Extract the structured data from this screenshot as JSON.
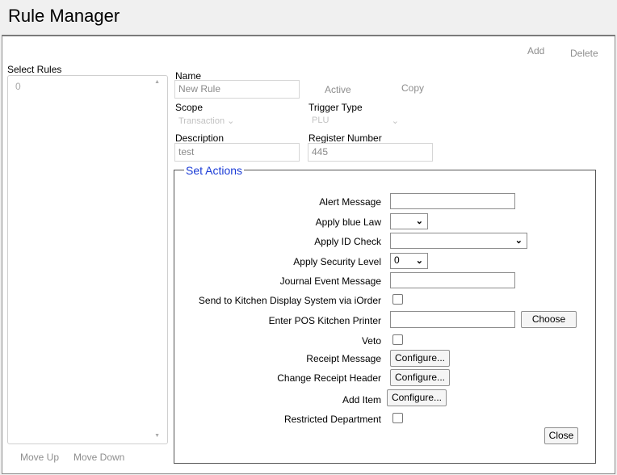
{
  "app": {
    "title": "Rule Manager"
  },
  "toolbar": {
    "add_label": "Add",
    "delete_label": "Delete"
  },
  "rules": {
    "header": "Select Rules",
    "items": [
      "0"
    ],
    "move_up_label": "Move Up",
    "move_down_label": "Move Down"
  },
  "form": {
    "name_label": "Name",
    "name_value": "New Rule",
    "active_label": "Active",
    "copy_label": "Copy",
    "scope_label": "Scope",
    "scope_value": "Transaction",
    "trigger_label": "Trigger Type",
    "trigger_value": "PLU",
    "description_label": "Description",
    "description_value": "test",
    "register_label": "Register Number",
    "register_value": "445"
  },
  "actions": {
    "legend": "Set Actions",
    "alert_message_label": "Alert Message",
    "alert_message_value": "",
    "blue_law_label": "Apply blue Law",
    "blue_law_value": "",
    "id_check_label": "Apply ID Check",
    "id_check_value": "",
    "security_level_label": "Apply Security Level",
    "security_level_value": "0",
    "journal_label": "Journal Event Message",
    "journal_value": "",
    "kds_label": "Send to Kitchen Display System via iOrder",
    "kitchen_printer_label": "Enter POS Kitchen Printer",
    "kitchen_printer_value": "",
    "choose_label": "Choose",
    "veto_label": "Veto",
    "receipt_message_label": "Receipt Message",
    "change_header_label": "Change Receipt Header",
    "add_item_label": "Add Item",
    "configure_label": "Configure...",
    "restricted_dept_label": "Restricted Department",
    "close_label": "Close"
  }
}
